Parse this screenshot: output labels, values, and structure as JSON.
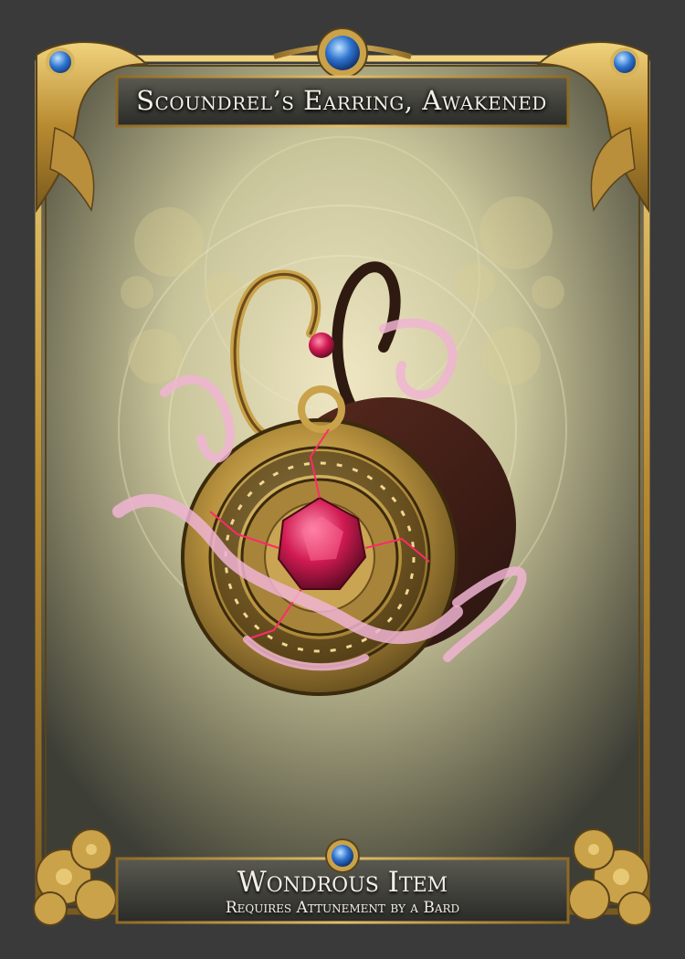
{
  "card": {
    "title": "Scoundrel’s Earring, Awakened",
    "type": "Wondrous Item",
    "attunement": "Requires Attunement by a Bard"
  },
  "icons": [
    "sapphire-gem-icon",
    "earring-medallion-icon",
    "floral-ornament-icon"
  ],
  "colors": {
    "frame_gold": "#c9a24a",
    "gem_blue": "#2f74d0",
    "ruby": "#c8184a",
    "smoke_pink": "#f0b4d2",
    "background": "#3a3a3a"
  }
}
